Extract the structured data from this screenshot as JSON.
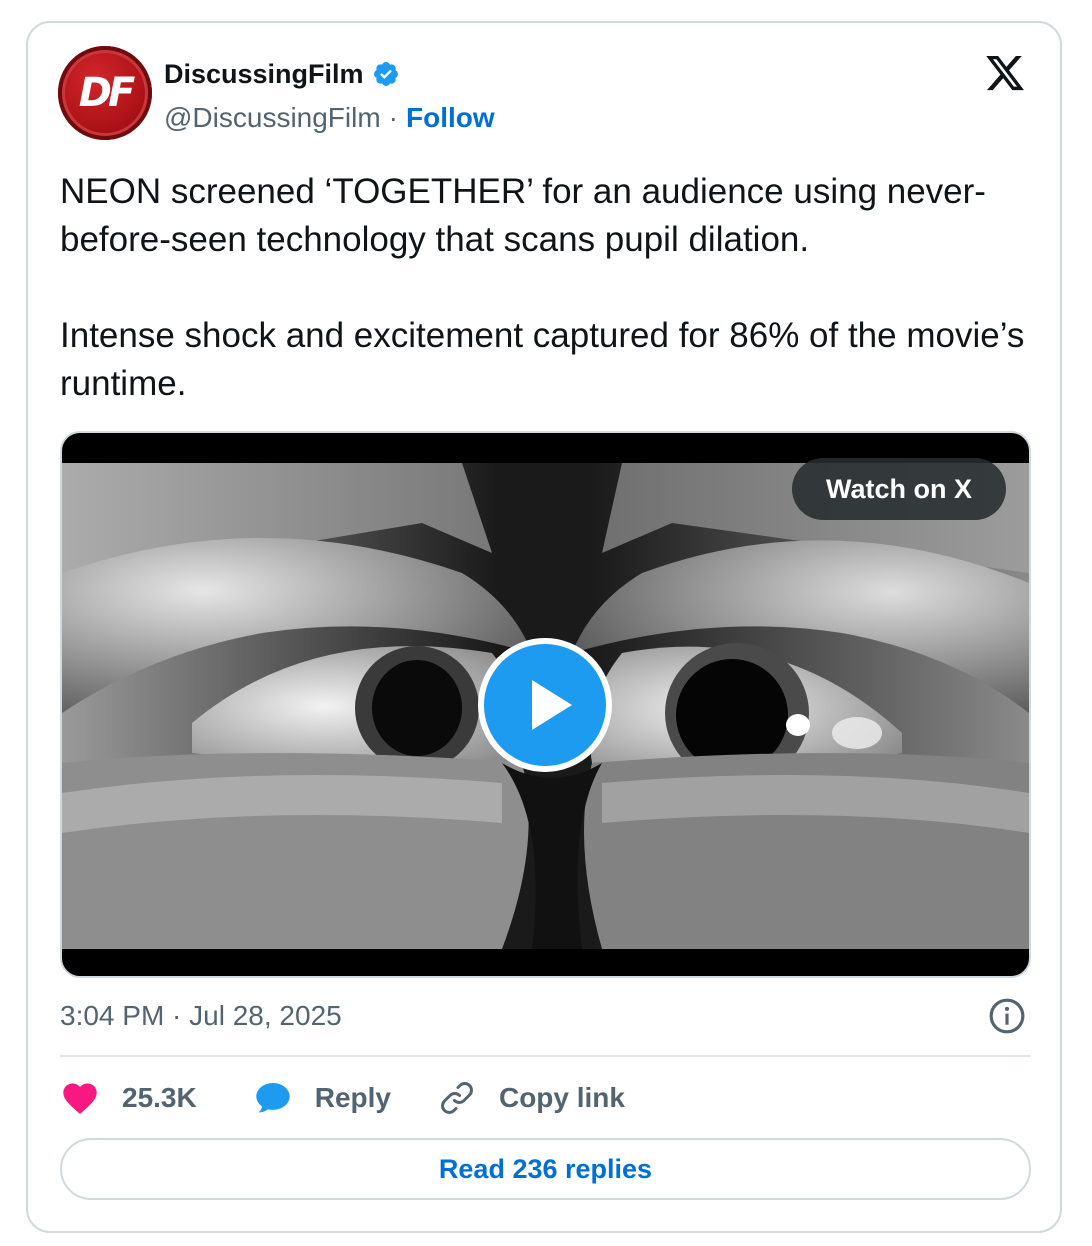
{
  "author": {
    "name": "DiscussingFilm",
    "handle": "@DiscussingFilm",
    "separator": "·",
    "follow_label": "Follow",
    "verified": true,
    "avatar_monogram": "DF"
  },
  "tweet": {
    "paragraphs": [
      "NEON screened ‘TOGETHER’ for an audience using never-before-seen technology that scans pupil dilation.",
      "Intense shock and excitement captured for 86% of the movie’s runtime."
    ]
  },
  "media": {
    "watch_label": "Watch on X",
    "play_icon": "play-icon"
  },
  "timestamp": "3:04 PM · Jul 28, 2025",
  "actions": {
    "likes": "25.3K",
    "reply_label": "Reply",
    "copy_link_label": "Copy link"
  },
  "read_replies_label": "Read 236 replies",
  "colors": {
    "accent": "#1d9bf0",
    "link": "#006fd6",
    "like": "#f91880",
    "muted": "#536471",
    "border": "#cfd9de"
  }
}
